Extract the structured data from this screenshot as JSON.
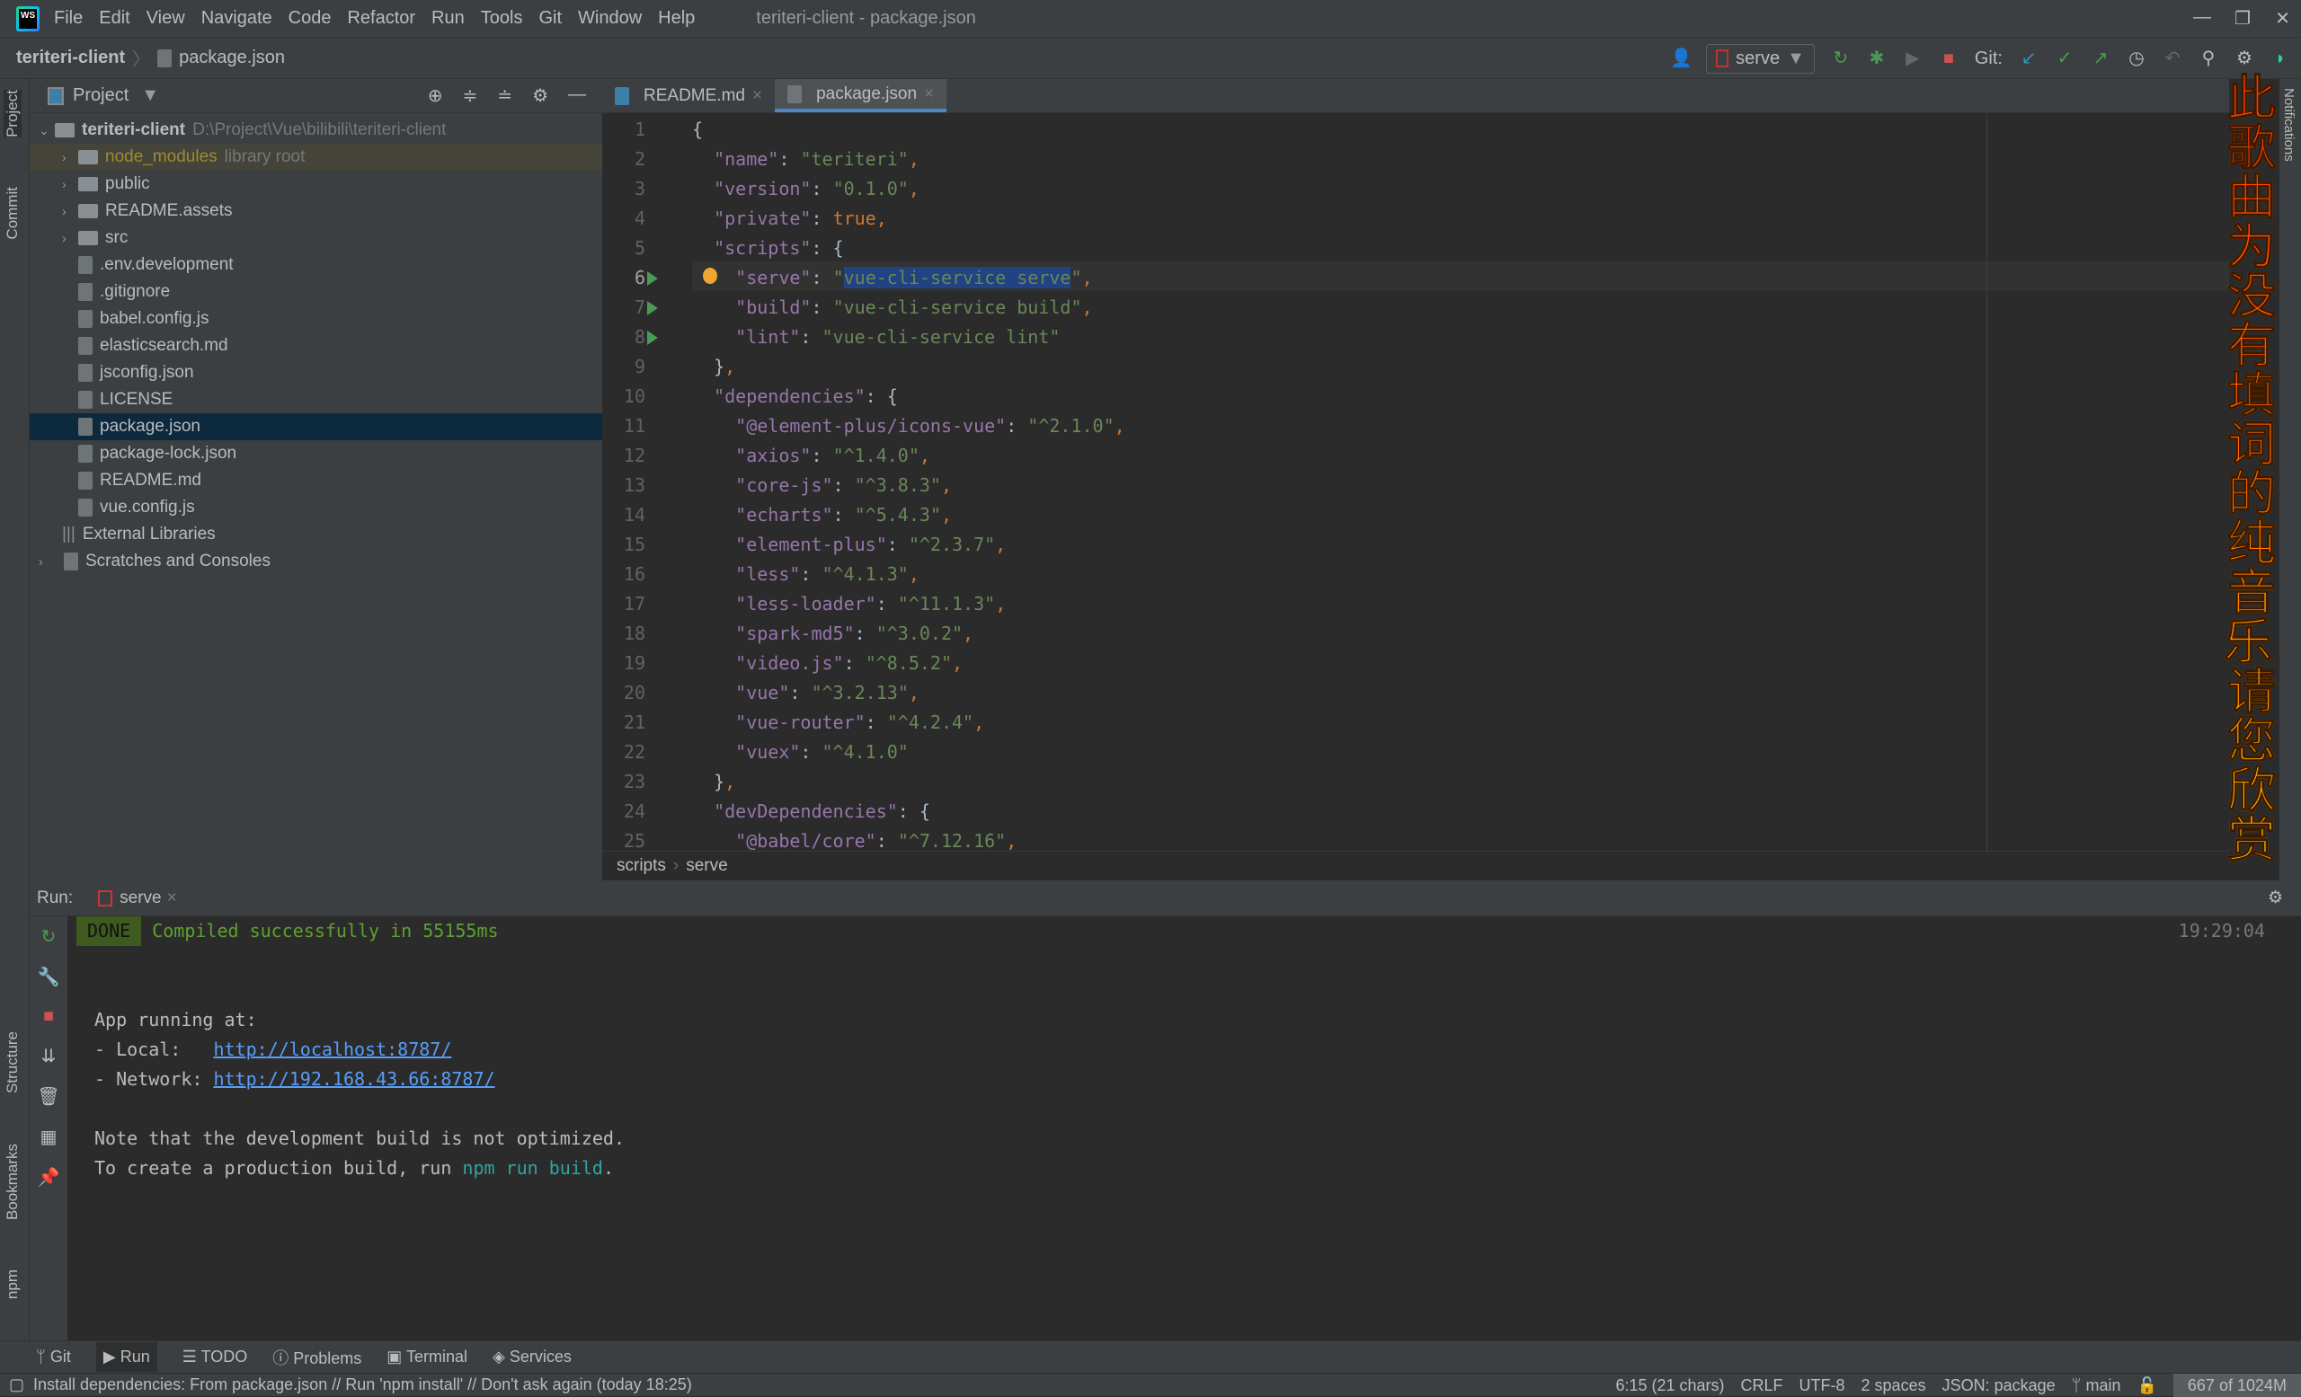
{
  "window": {
    "title": "teriteri-client - package.json",
    "menu": [
      "File",
      "Edit",
      "View",
      "Navigate",
      "Code",
      "Refactor",
      "Run",
      "Tools",
      "Git",
      "Window",
      "Help"
    ]
  },
  "nav": {
    "project": "teriteri-client",
    "file": "package.json",
    "run_config": "serve",
    "git_label": "Git:"
  },
  "left_strip": [
    "Project",
    "Commit",
    "Structure",
    "Bookmarks",
    "npm"
  ],
  "project": {
    "title": "Project",
    "root": "teriteri-client",
    "root_path": "D:\\Project\\Vue\\bilibili\\teriteri-client",
    "items": [
      {
        "label": "node_modules",
        "note": "library root",
        "type": "folder"
      },
      {
        "label": "public",
        "type": "folder"
      },
      {
        "label": "README.assets",
        "type": "folder"
      },
      {
        "label": "src",
        "type": "folder"
      },
      {
        "label": ".env.development",
        "type": "file"
      },
      {
        "label": ".gitignore",
        "type": "file"
      },
      {
        "label": "babel.config.js",
        "type": "file"
      },
      {
        "label": "elasticsearch.md",
        "type": "file"
      },
      {
        "label": "jsconfig.json",
        "type": "file"
      },
      {
        "label": "LICENSE",
        "type": "file"
      },
      {
        "label": "package.json",
        "type": "file",
        "selected": true
      },
      {
        "label": "package-lock.json",
        "type": "file"
      },
      {
        "label": "README.md",
        "type": "file"
      },
      {
        "label": "vue.config.js",
        "type": "file"
      }
    ],
    "external": "External Libraries",
    "scratches": "Scratches and Consoles"
  },
  "editor": {
    "tabs": [
      "README.md",
      "package.json"
    ],
    "active_tab": "package.json",
    "breadcrumb": [
      "scripts",
      "serve"
    ],
    "lines": [
      "{",
      "  \"name\": \"teriteri\",",
      "  \"version\": \"0.1.0\",",
      "  \"private\": true,",
      "  \"scripts\": {",
      "    \"serve\": \"vue-cli-service serve\",",
      "    \"build\": \"vue-cli-service build\",",
      "    \"lint\": \"vue-cli-service lint\"",
      "  },",
      "  \"dependencies\": {",
      "    \"@element-plus/icons-vue\": \"^2.1.0\",",
      "    \"axios\": \"^1.4.0\",",
      "    \"core-js\": \"^3.8.3\",",
      "    \"echarts\": \"^5.4.3\",",
      "    \"element-plus\": \"^2.3.7\",",
      "    \"less\": \"^4.1.3\",",
      "    \"less-loader\": \"^11.1.3\",",
      "    \"spark-md5\": \"^3.0.2\",",
      "    \"video.js\": \"^8.5.2\",",
      "    \"vue\": \"^3.2.13\",",
      "    \"vue-router\": \"^4.2.4\",",
      "    \"vuex\": \"^4.1.0\"",
      "  },",
      "  \"devDependencies\": {",
      "    \"@babel/core\": \"^7.12.16\","
    ]
  },
  "run": {
    "label": "Run:",
    "tab": "serve",
    "done": "DONE",
    "compiled": "Compiled successfully in 55155ms",
    "time": "19:29:04",
    "app_running": "App running at:",
    "local_label": "- Local:   ",
    "local_url": "http://localhost:8787/",
    "network_label": "- Network: ",
    "network_url": "http://192.168.43.66:8787/",
    "note": "Note that the development build is not optimized.",
    "prod_prefix": "To create a production build, run ",
    "prod_cmd": "npm run build",
    "prod_suffix": "."
  },
  "bottom_tabs": [
    "Git",
    "Run",
    "TODO",
    "Problems",
    "Terminal",
    "Services"
  ],
  "status": {
    "message": "Install dependencies: From package.json // Run 'npm install' // Don't ask again (today 18:25)",
    "position": "6:15 (21 chars)",
    "line_sep": "CRLF",
    "encoding": "UTF-8",
    "indent": "2 spaces",
    "schema": "JSON: package",
    "branch": "main",
    "memory": "667 of 1024M"
  },
  "overlay_text": "此歌曲为没有填词的纯音乐，请您欣赏",
  "right_strip": "Notifications"
}
